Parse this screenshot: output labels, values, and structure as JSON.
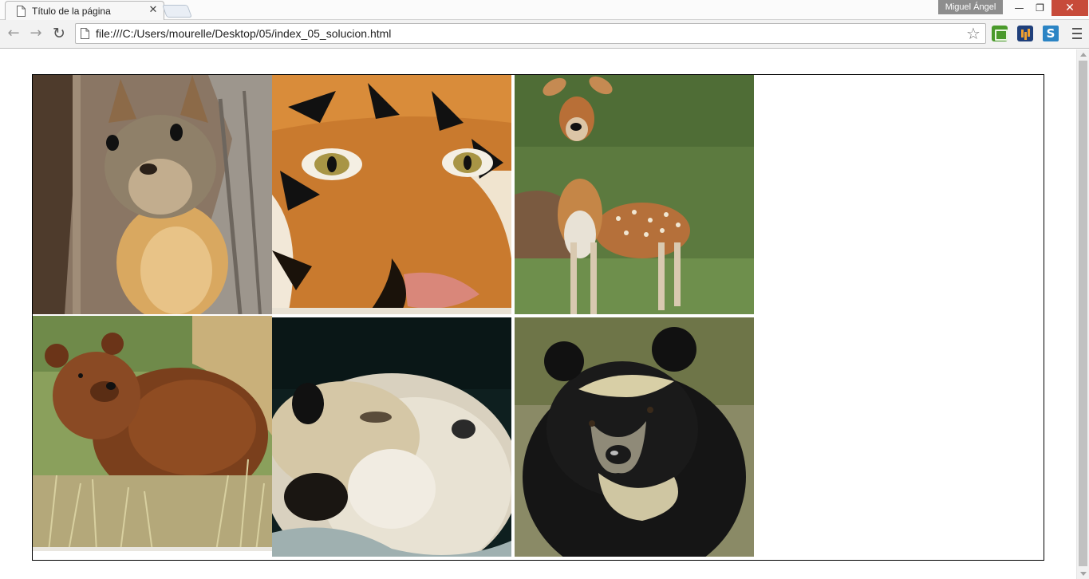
{
  "browser": {
    "tab_title": "Título de la página",
    "tab_close_glyph": "✕",
    "profile_name": "Miguel Ángel",
    "url": "file:///C:/Users/mourelle/Desktop/05/index_05_solucion.html",
    "window_controls": {
      "minimize": "—",
      "maximize": "❐",
      "close": "✕"
    },
    "nav": {
      "back": "←",
      "forward": "→",
      "reload": "↻"
    },
    "star": "☆",
    "extensions": [
      "print-icon",
      "chart-extension-icon",
      "s-extension-icon"
    ]
  },
  "gallery": {
    "photos": [
      {
        "subject": "squirrel"
      },
      {
        "subject": "tiger"
      },
      {
        "subject": "deer"
      },
      {
        "subject": "brown-bear"
      },
      {
        "subject": "sea-otter"
      },
      {
        "subject": "spectacled-bear"
      }
    ]
  }
}
